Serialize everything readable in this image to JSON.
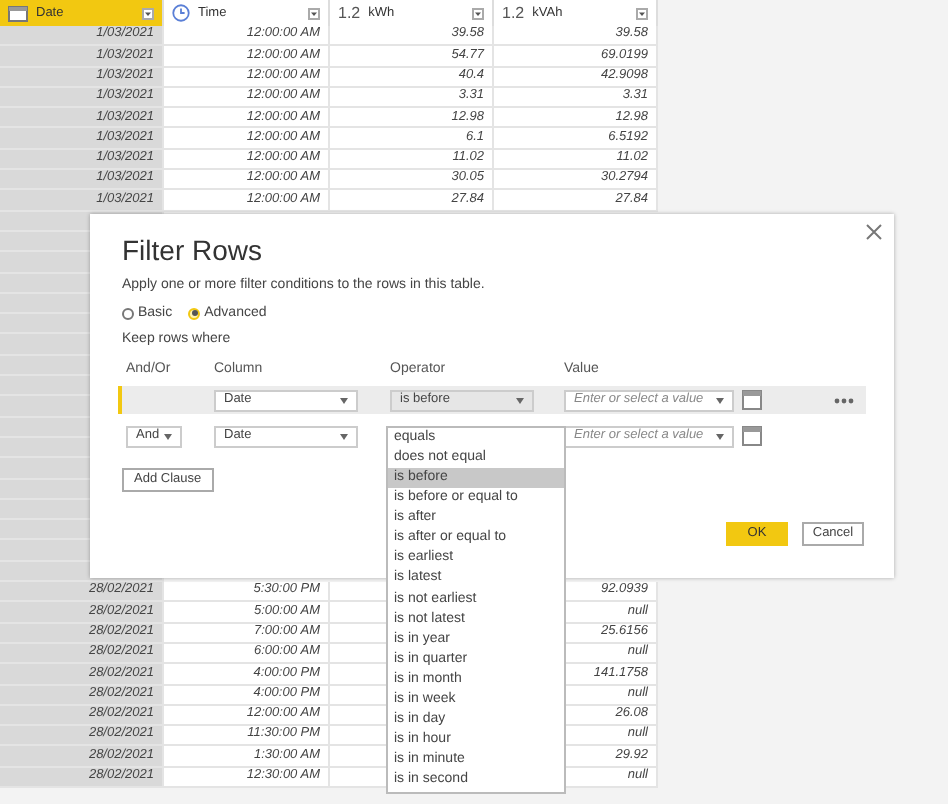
{
  "table": {
    "columns": [
      {
        "label": "Date",
        "kind": "date",
        "selected": true
      },
      {
        "label": "Time",
        "kind": "time",
        "selected": false
      },
      {
        "label": "kWh",
        "kind": "decimal",
        "type_label": "1.2",
        "selected": false
      },
      {
        "label": "kVAh",
        "kind": "decimal",
        "type_label": "1.2",
        "selected": false
      }
    ],
    "top_rows": [
      [
        "1/03/2021",
        "12:00:00 AM",
        "39.58",
        "39.58"
      ],
      [
        "1/03/2021",
        "12:00:00 AM",
        "54.77",
        "69.0199"
      ],
      [
        "1/03/2021",
        "12:00:00 AM",
        "40.4",
        "42.9098"
      ],
      [
        "1/03/2021",
        "12:00:00 AM",
        "3.31",
        "3.31"
      ],
      [
        "1/03/2021",
        "12:00:00 AM",
        "12.98",
        "12.98"
      ],
      [
        "1/03/2021",
        "12:00:00 AM",
        "6.1",
        "6.5192"
      ],
      [
        "1/03/2021",
        "12:00:00 AM",
        "11.02",
        "11.02"
      ],
      [
        "1/03/2021",
        "12:00:00 AM",
        "30.05",
        "30.2794"
      ],
      [
        "1/03/2021",
        "12:00:00 AM",
        "27.84",
        "27.84"
      ]
    ],
    "bottom_rows": [
      [
        "28/02/2021",
        "5:30:00 PM",
        "",
        "92.0939"
      ],
      [
        "28/02/2021",
        "5:00:00 AM",
        "",
        "null"
      ],
      [
        "28/02/2021",
        "7:00:00 AM",
        "",
        "25.6156"
      ],
      [
        "28/02/2021",
        "6:00:00 AM",
        "",
        "null"
      ],
      [
        "28/02/2021",
        "4:00:00 PM",
        "",
        "141.1758"
      ],
      [
        "28/02/2021",
        "4:00:00 PM",
        "",
        "null"
      ],
      [
        "28/02/2021",
        "12:00:00 AM",
        "",
        "26.08"
      ],
      [
        "28/02/2021",
        "11:30:00 PM",
        "",
        "null"
      ],
      [
        "28/02/2021",
        "1:30:00 AM",
        "",
        "29.92"
      ],
      [
        "28/02/2021",
        "12:30:00 AM",
        "",
        "null"
      ]
    ]
  },
  "dialog": {
    "title": "Filter Rows",
    "description": "Apply one or more filter conditions to the rows in this table.",
    "modes": [
      {
        "label": "Basic",
        "selected": false
      },
      {
        "label": "Advanced",
        "selected": true
      }
    ],
    "keep_label": "Keep rows where",
    "headers": [
      "And/Or",
      "Column",
      "Operator",
      "Value"
    ],
    "clauses": [
      {
        "column": "Date",
        "operator": "is before",
        "value_placeholder": "Enter or select a value",
        "selected": true
      },
      {
        "and_or": "And",
        "column": "Date",
        "value_placeholder": "Enter or select a value",
        "selected": false
      }
    ],
    "add_clause": "Add Clause",
    "ok": "OK",
    "cancel": "Cancel"
  },
  "operator_menu": [
    {
      "label": "equals",
      "selected": false
    },
    {
      "label": "does not equal",
      "selected": false
    },
    {
      "label": "is before",
      "selected": true
    },
    {
      "label": "is before or equal to",
      "selected": false
    },
    {
      "label": "is after",
      "selected": false
    },
    {
      "label": "is after or equal to",
      "selected": false
    },
    {
      "label": "is earliest",
      "selected": false
    },
    {
      "label": "is latest",
      "selected": false
    },
    {
      "label": "is not earliest",
      "selected": false
    },
    {
      "label": "is not latest",
      "selected": false
    },
    {
      "label": "is in year",
      "selected": false
    },
    {
      "label": "is in quarter",
      "selected": false
    },
    {
      "label": "is in month",
      "selected": false
    },
    {
      "label": "is in week",
      "selected": false
    },
    {
      "label": "is in day",
      "selected": false
    },
    {
      "label": "is in hour",
      "selected": false
    },
    {
      "label": "is in minute",
      "selected": false
    },
    {
      "label": "is in second",
      "selected": false
    }
  ]
}
